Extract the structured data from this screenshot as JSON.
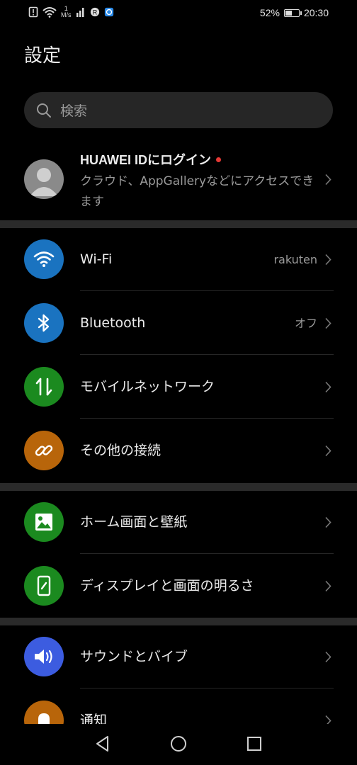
{
  "status_bar": {
    "speed_value": "1",
    "speed_unit": "M/s",
    "battery_percent": "52%",
    "battery_level": 0.52,
    "time": "20:30"
  },
  "page": {
    "title": "設定"
  },
  "search": {
    "placeholder": "検索"
  },
  "account": {
    "title": "HUAWEI IDにログイン",
    "subtitle": "クラウド、AppGalleryなどにアクセスできます"
  },
  "settings": {
    "wifi": {
      "label": "Wi-Fi",
      "value": "rakuten",
      "icon": "wifi-icon",
      "color": "#1a73c0"
    },
    "bluetooth": {
      "label": "Bluetooth",
      "value": "オフ",
      "icon": "bluetooth-icon",
      "color": "#1a73c0"
    },
    "mobile_network": {
      "label": "モバイルネットワーク",
      "icon": "mobile-data-icon",
      "color": "#1b8a1f"
    },
    "other_connections": {
      "label": "その他の接続",
      "icon": "link-icon",
      "color": "#b8650a"
    },
    "home_wallpaper": {
      "label": "ホーム画面と壁紙",
      "icon": "image-icon",
      "color": "#1b8a1f"
    },
    "display": {
      "label": "ディスプレイと画面の明るさ",
      "icon": "display-icon",
      "color": "#1b8a1f"
    },
    "sound": {
      "label": "サウンドとバイブ",
      "icon": "speaker-icon",
      "color": "#3c5ce0"
    },
    "notifications": {
      "label": "通知",
      "icon": "bell-icon",
      "color": "#b8650a"
    }
  }
}
